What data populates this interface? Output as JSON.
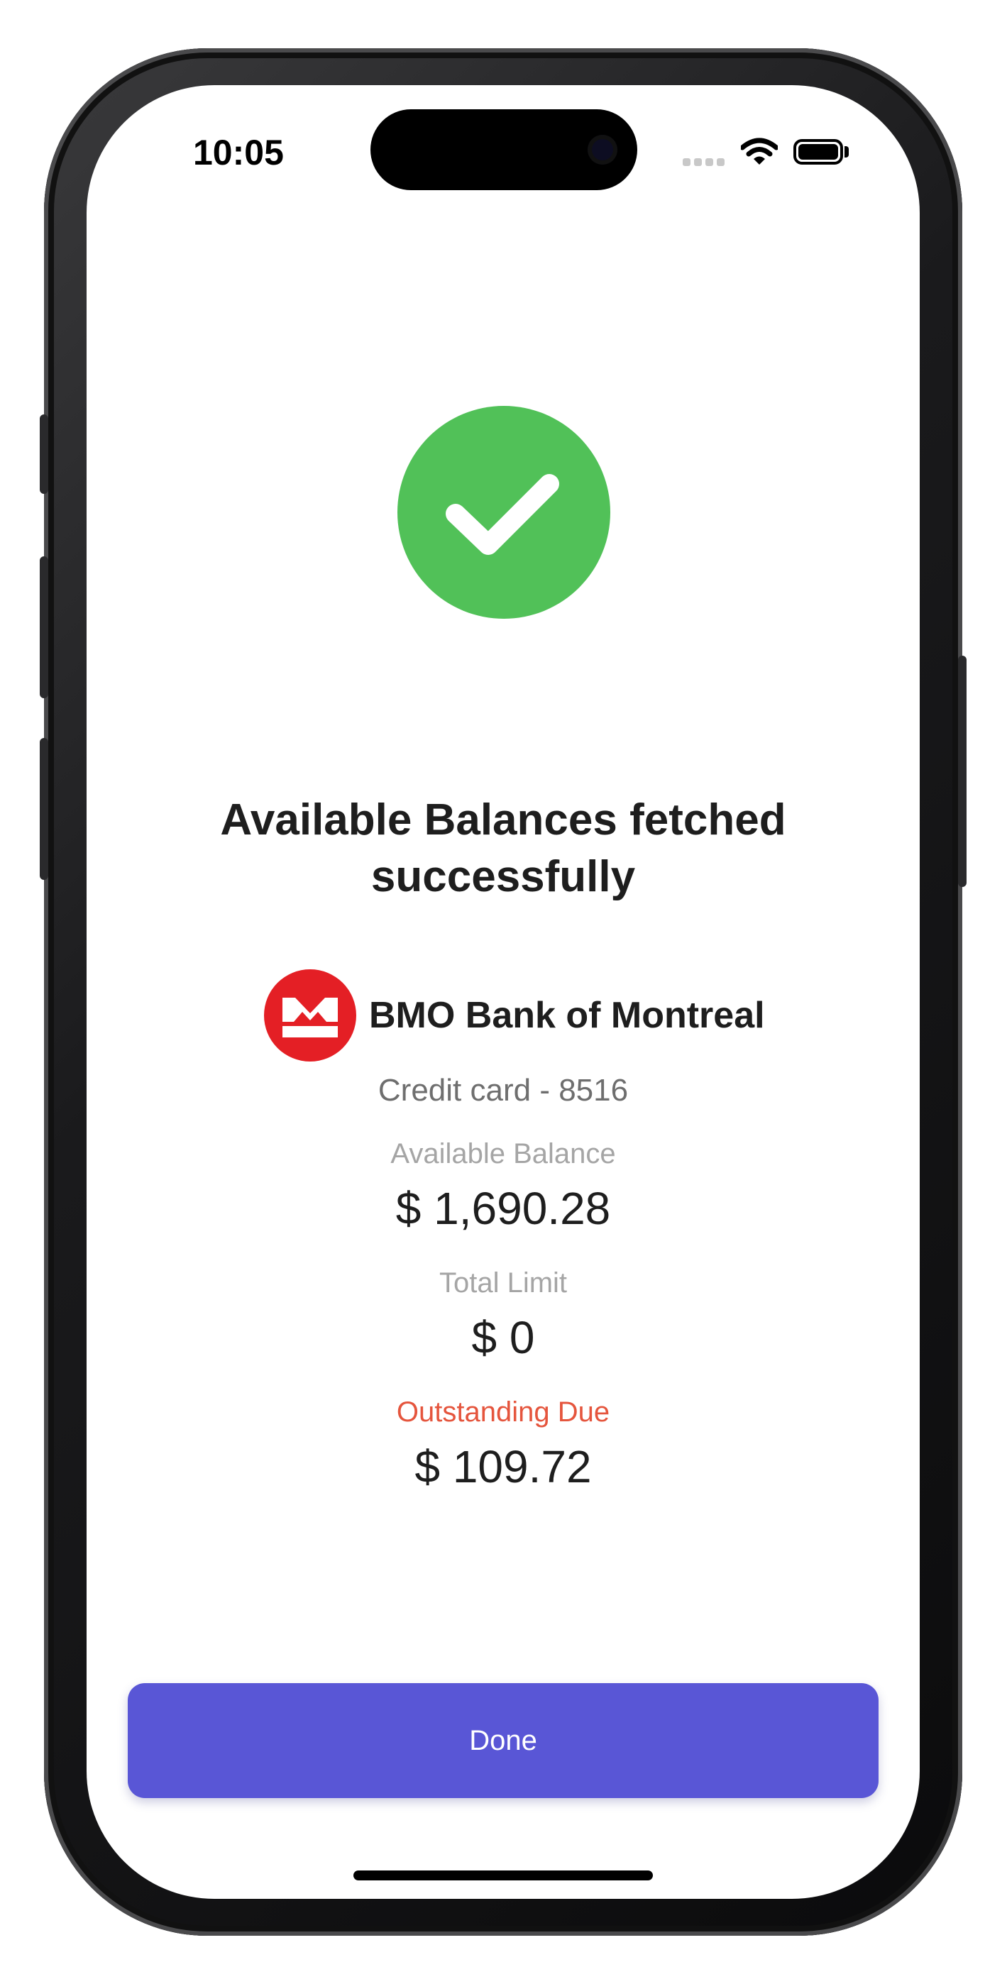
{
  "status_bar": {
    "time": "10:05",
    "icons": [
      "cellular-signal-icon",
      "wifi-icon",
      "battery-icon"
    ]
  },
  "result": {
    "icon": "checkmark-circle-icon",
    "title_line1": "Available Balances fetched",
    "title_line2": "successfully"
  },
  "account": {
    "bank_logo": "bmo-logo",
    "bank_name": "BMO Bank of Montreal",
    "card_label": "Credit card - 8516"
  },
  "balances": {
    "available_label": "Available Balance",
    "available_value": "$ 1,690.28",
    "limit_label": "Total Limit",
    "limit_value": "$ 0",
    "due_label": "Outstanding Due",
    "due_value": "$ 109.72"
  },
  "actions": {
    "done_label": "Done"
  },
  "colors": {
    "success": "#51c158",
    "primary": "#5956d6",
    "due": "#e5553d",
    "bank_brand": "#e41f25"
  }
}
